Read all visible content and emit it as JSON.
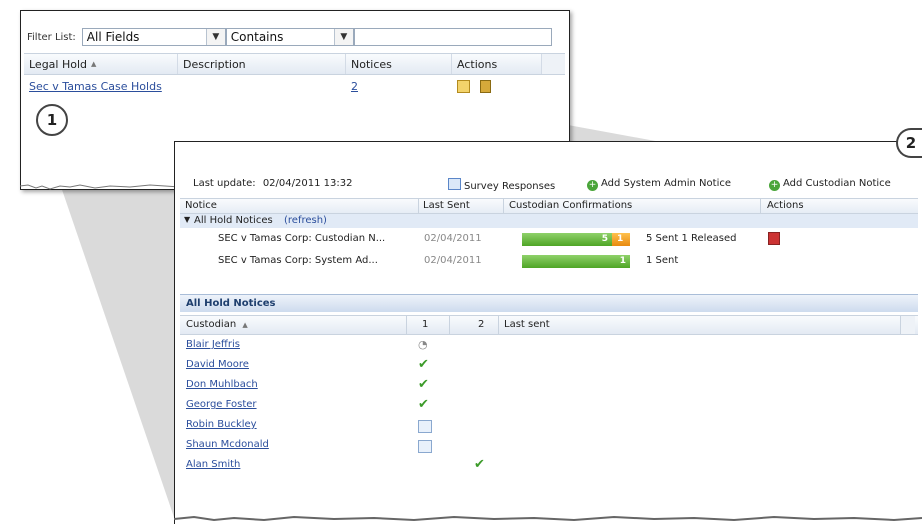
{
  "panel1": {
    "filter_label": "Filter List:",
    "field_select": "All Fields",
    "operator_select": "Contains",
    "filter_value": "",
    "columns": [
      "Legal Hold",
      "Description",
      "Notices",
      "Actions"
    ],
    "sort_indicator": "▲",
    "rows": [
      {
        "legal_hold": "Sec v Tamas Case Holds",
        "description": "",
        "notices": "2"
      }
    ],
    "callout": "1"
  },
  "panel2": {
    "callout": "2",
    "last_update_label": "Last update:",
    "last_update_value": "02/04/2011 13:32",
    "toolbar": {
      "survey": "Survey Responses",
      "add_admin": "Add System Admin Notice",
      "add_custodian": "Add Custodian Notice"
    },
    "notice_columns": [
      "Notice",
      "Last Sent",
      "Custodian Confirmations",
      "Actions"
    ],
    "group_label": "All Hold Notices",
    "refresh_label": "(refresh)",
    "notices": [
      {
        "name": "SEC v Tamas Corp: Custodian N...",
        "last_sent": "02/04/2011",
        "green_label": "5",
        "orange_label": "1",
        "summary": "5 Sent  1 Released",
        "green_fraction": 0.83,
        "orange_fraction": 0.17
      },
      {
        "name": "SEC v Tamas Corp: System Ad...",
        "last_sent": "02/04/2011",
        "green_label": "1",
        "orange_label": "",
        "summary": "1 Sent",
        "green_fraction": 1.0,
        "orange_fraction": 0.0
      }
    ],
    "section_title": "All Hold Notices",
    "custodian_columns": [
      "Custodian",
      "1",
      "2",
      "Last sent"
    ],
    "custodians": [
      {
        "name": "Blair Jeffris",
        "n1": "clock",
        "n2": ""
      },
      {
        "name": "David Moore",
        "n1": "check",
        "n2": ""
      },
      {
        "name": "Don Muhlbach",
        "n1": "check",
        "n2": ""
      },
      {
        "name": "George Foster",
        "n1": "check",
        "n2": ""
      },
      {
        "name": "Robin Buckley",
        "n1": "mail",
        "n2": ""
      },
      {
        "name": "Shaun Mcdonald",
        "n1": "mail",
        "n2": ""
      },
      {
        "name": "Alan Smith",
        "n1": "",
        "n2": "check"
      }
    ]
  },
  "colors": {
    "link": "#2b4e9c",
    "bar_green": "#4fa526",
    "bar_orange": "#e88a10",
    "header_blue": "#e1eaf6"
  }
}
